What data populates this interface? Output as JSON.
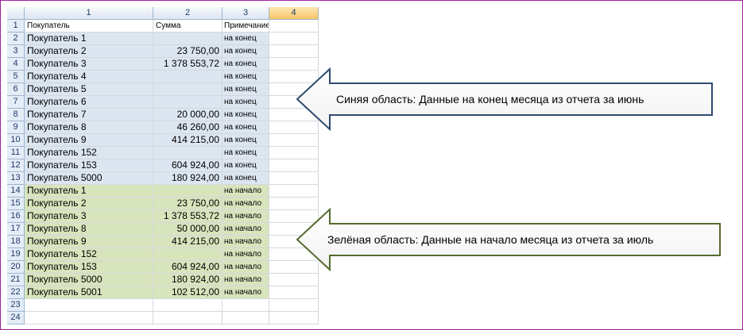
{
  "sheet": {
    "column_headers": [
      "1",
      "2",
      "3",
      "4"
    ],
    "header_row": {
      "row_num": "1",
      "c1": "Покупатель",
      "c2": "Сумма",
      "c3": "Примечание"
    },
    "rows": [
      {
        "n": "2",
        "buyer": "Покупатель 1",
        "sum": "",
        "note": "на конец",
        "zone": "blue"
      },
      {
        "n": "3",
        "buyer": "Покупатель 2",
        "sum": "23 750,00",
        "note": "на конец",
        "zone": "blue"
      },
      {
        "n": "4",
        "buyer": "Покупатель 3",
        "sum": "1 378 553,72",
        "note": "на конец",
        "zone": "blue"
      },
      {
        "n": "5",
        "buyer": "Покупатель 4",
        "sum": "",
        "note": "на конец",
        "zone": "blue"
      },
      {
        "n": "6",
        "buyer": "Покупатель 5",
        "sum": "",
        "note": "на конец",
        "zone": "blue"
      },
      {
        "n": "7",
        "buyer": "Покупатель 6",
        "sum": "",
        "note": "на конец",
        "zone": "blue"
      },
      {
        "n": "8",
        "buyer": "Покупатель 7",
        "sum": "20 000,00",
        "note": "на конец",
        "zone": "blue"
      },
      {
        "n": "9",
        "buyer": "Покупатель 8",
        "sum": "46 260,00",
        "note": "на конец",
        "zone": "blue"
      },
      {
        "n": "10",
        "buyer": "Покупатель 9",
        "sum": "414 215,00",
        "note": "на конец",
        "zone": "blue"
      },
      {
        "n": "11",
        "buyer": "Покупатель 152",
        "sum": "",
        "note": "на конец",
        "zone": "blue"
      },
      {
        "n": "12",
        "buyer": "Покупатель 153",
        "sum": "604 924,00",
        "note": "на конец",
        "zone": "blue"
      },
      {
        "n": "13",
        "buyer": "Покупатель 5000",
        "sum": "180 924,00",
        "note": "на конец",
        "zone": "blue"
      },
      {
        "n": "14",
        "buyer": "Покупатель 1",
        "sum": "",
        "note": "на начало",
        "zone": "green"
      },
      {
        "n": "15",
        "buyer": "Покупатель 2",
        "sum": "23 750,00",
        "note": "на начало",
        "zone": "green"
      },
      {
        "n": "16",
        "buyer": "Покупатель 3",
        "sum": "1 378 553,72",
        "note": "на начало",
        "zone": "green"
      },
      {
        "n": "17",
        "buyer": "Покупатель 8",
        "sum": "50 000,00",
        "note": "на начало",
        "zone": "green"
      },
      {
        "n": "18",
        "buyer": "Покупатель 9",
        "sum": "414 215,00",
        "note": "на начало",
        "zone": "green"
      },
      {
        "n": "19",
        "buyer": "Покупатель 152",
        "sum": "",
        "note": "на начало",
        "zone": "green"
      },
      {
        "n": "20",
        "buyer": "Покупатель 153",
        "sum": "604 924,00",
        "note": "на начало",
        "zone": "green"
      },
      {
        "n": "21",
        "buyer": "Покупатель 5000",
        "sum": "180 924,00",
        "note": "на начало",
        "zone": "green"
      },
      {
        "n": "22",
        "buyer": "Покупатель 5001",
        "sum": "102 512,00",
        "note": "на начало",
        "zone": "green"
      },
      {
        "n": "23",
        "buyer": "",
        "sum": "",
        "note": "",
        "zone": "none"
      },
      {
        "n": "24",
        "buyer": "",
        "sum": "",
        "note": "",
        "zone": "none"
      }
    ]
  },
  "callouts": {
    "blue_text": "Синяя область: Данные на конец месяца из отчета за июнь",
    "green_text": "Зелёная область: Данные на начало месяца из отчета за июль",
    "blue_arrow_color": "#2f4a6f",
    "green_arrow_color": "#556b2f"
  },
  "colors": {
    "blue_zone": "#dce6f1",
    "green_zone": "#d8e4bc",
    "selected_column_header": "#f8c463",
    "frame_border": "#a020a0"
  }
}
